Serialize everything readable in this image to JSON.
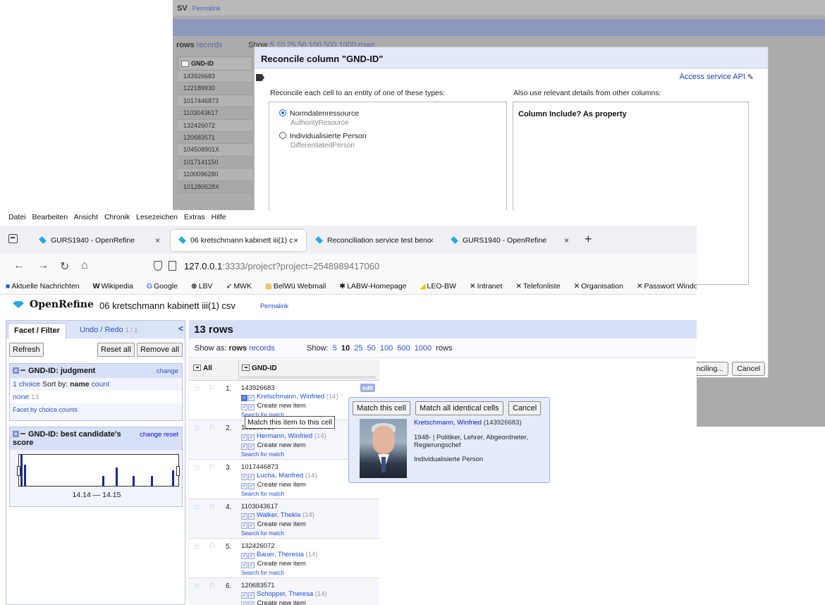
{
  "bg": {
    "top_title": "SV",
    "permalink": "Permalink",
    "rows_label": "rows",
    "records_label": "records",
    "show_label": "Show",
    "show_options": "5  10  25  50  100  500  1000  rows",
    "col_header": "GND-ID",
    "cells": [
      "143926683",
      "122189930",
      "1017446873",
      "1103043617",
      "132426072",
      "120683571",
      "104508901X",
      "1017141150",
      "1100096280",
      "101280528X"
    ]
  },
  "dialog": {
    "title": "Reconcile column \"GND-ID\"",
    "access_api": "Access service API",
    "types_label": "Reconcile each cell to an entity of one of these types:",
    "details_label": "Also use relevant details from other columns:",
    "types": [
      {
        "label": "Normdatenressource",
        "sub": "AuthorityResource",
        "selected": true
      },
      {
        "label": "Individualisierte Person",
        "sub": "DifferentiatedPerson",
        "selected": false
      }
    ],
    "details_header": "Column Include? As property",
    "btn_start": "nciling...",
    "btn_cancel": "Cancel"
  },
  "browser": {
    "menu": [
      "Datei",
      "Bearbeiten",
      "Ansicht",
      "Chronik",
      "Lesezeichen",
      "Extras",
      "Hilfe"
    ],
    "tabs": [
      {
        "label": "GURS1940 - OpenRefine",
        "active": false
      },
      {
        "label": "06 kretschmann kabinett iii(1) c",
        "active": true
      },
      {
        "label": "Reconciliation service test benc",
        "active": false
      },
      {
        "label": "GURS1940 - OpenRefine",
        "active": false
      }
    ],
    "url_host": "127.0.0.1",
    "url_rest": ":3333/project?project=2548989417060",
    "bookmarks": [
      "Aktuelle Nachrichten",
      "Wikipedia",
      "Google",
      "LBV",
      "MWK",
      "BelWü Webmail",
      "LABW-Homepage",
      "LEO-BW",
      "Intranet",
      "Telefonliste",
      "Organisation",
      "Passwort Windows-D"
    ]
  },
  "openrefine": {
    "brand": "OpenRefine",
    "project": "06 kretschmann kabinett iii(1) csv",
    "permalink": "Permalink",
    "tab_facet": "Facet / Filter",
    "tab_undo": "Undo / Redo",
    "undo_count": "1 / 1",
    "refresh": "Refresh",
    "reset_all": "Reset all",
    "remove_all": "Remove all",
    "facet1": {
      "title": "GND-ID: judgment",
      "change": "change",
      "choices": "1 choice",
      "sort_by": "Sort by:",
      "sort_name": "name",
      "sort_count": "count",
      "item": "none",
      "item_count": "13",
      "facet_by": "Facet by choice counts"
    },
    "facet2": {
      "title": "GND-ID: best candidate's score",
      "change": "change",
      "reset": "reset",
      "range": "14.14 — 14.15"
    },
    "rows_title": "13 rows",
    "show_as": "Show as:",
    "rows_mode": "rows",
    "records_mode": "records",
    "show": "Show:",
    "page_sizes": [
      "5",
      "10",
      "25",
      "50",
      "100",
      "500",
      "1000"
    ],
    "rows_suffix": "rows",
    "col_all": "All",
    "col_gnd": "GND-ID",
    "edit": "edit",
    "create_new": "Create new item",
    "search_match": "Search for match",
    "rows": [
      {
        "n": "1.",
        "id": "143926683",
        "cand": "Kretschmann, Winfried",
        "score": "(14)"
      },
      {
        "n": "2.",
        "id": "122189930",
        "cand": "Hermann, Winfried",
        "score": "(14)"
      },
      {
        "n": "3.",
        "id": "1017446873",
        "cand": "Lucha, Manfred",
        "score": "(14)"
      },
      {
        "n": "4.",
        "id": "1103043617",
        "cand": "Walker, Thekla",
        "score": "(14)"
      },
      {
        "n": "5.",
        "id": "132426072",
        "cand": "Bauer, Theresia",
        "score": "(14)"
      },
      {
        "n": "6.",
        "id": "120683571",
        "cand": "Schopper, Theresa",
        "score": "(14)"
      }
    ],
    "tooltip": "Match this item to this cell",
    "popup": {
      "match_cell": "Match this cell",
      "match_all": "Match all identical cells",
      "cancel": "Cancel",
      "name": "Kretschmann, Winfried",
      "id": "(143926683)",
      "desc": "1948- | Politiker, Lehrer, Abgeordneter, Regierungschef",
      "type": "Individualisierte Person"
    }
  }
}
